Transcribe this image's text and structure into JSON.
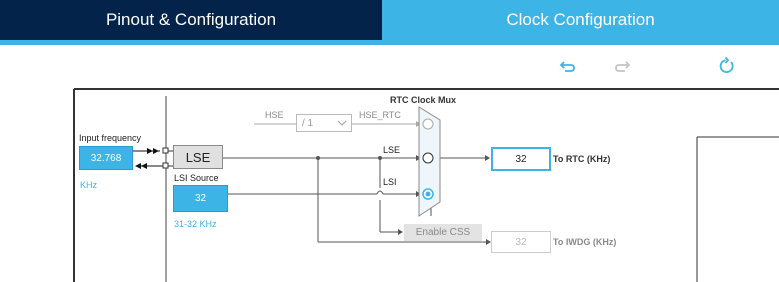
{
  "tabs": [
    {
      "label": "Pinout & Configuration",
      "active": false
    },
    {
      "label": "Clock Configuration",
      "active": true
    }
  ],
  "toolbar": {
    "undo_icon": "undo-icon",
    "redo_icon": "redo-icon",
    "reset_icon": "reset-icon"
  },
  "diagram": {
    "mux_title": "RTC Clock Mux",
    "input_frequency_label": "Input frequency",
    "input_frequency_value": "32.768",
    "input_frequency_unit": "KHz",
    "lse_label": "LSE",
    "lsi_source_label": "LSI Source",
    "lsi_source_value": "32",
    "lsi_source_range": "31-32 KHz",
    "hse_label": "HSE",
    "hse_divider_value": "/ 1",
    "hse_rtc_label": "HSE_RTC",
    "mux_lse_label": "LSE",
    "mux_lsi_label": "LSI",
    "rtc_value": "32",
    "rtc_label": "To RTC (KHz)",
    "enable_css_label": "Enable CSS",
    "iwdg_value": "32",
    "iwdg_label": "To IWDG (KHz)"
  },
  "colors": {
    "tab_inactive": "#03234b",
    "tab_active": "#3cb4e6",
    "accent": "#3cb4e6"
  }
}
